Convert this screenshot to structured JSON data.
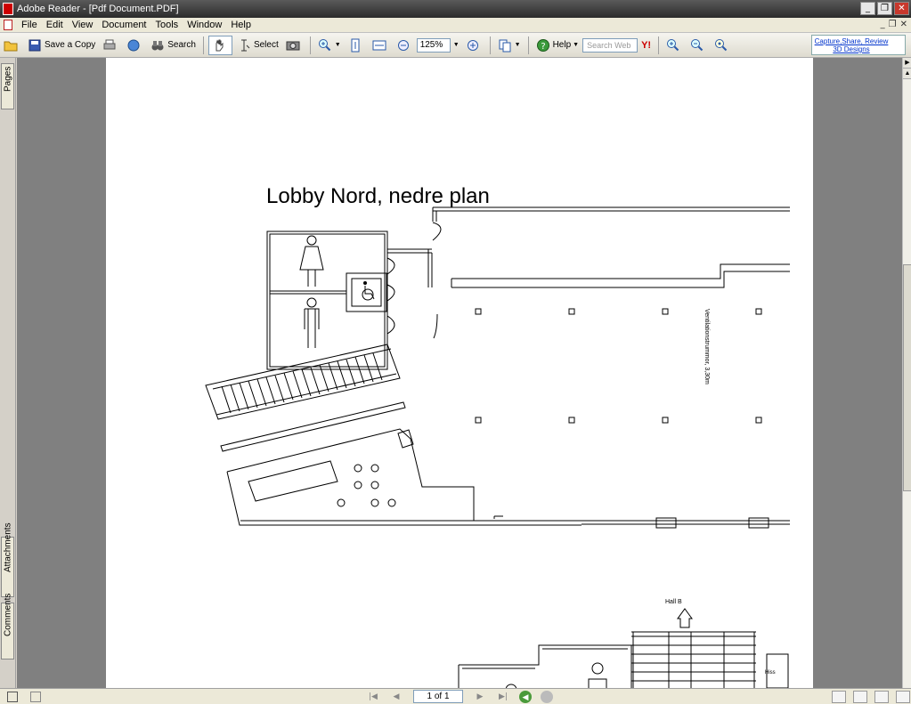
{
  "window": {
    "title": "Adobe Reader - [Pdf Document.PDF]",
    "minimize": "_",
    "restore": "❐",
    "close": "✕"
  },
  "menu": {
    "items": [
      "File",
      "Edit",
      "View",
      "Document",
      "Tools",
      "Window",
      "Help"
    ]
  },
  "toolbar": {
    "save_copy_label": "Save a Copy",
    "search_label": "Search",
    "select_label": "Select",
    "zoom_value": "125%",
    "help_label": "Help",
    "search_web_placeholder": "Search Web",
    "promo_text": "Capture,Share, Review 3D Designs"
  },
  "sidebar": {
    "tabs": [
      "Pages",
      "Attachments",
      "Comments"
    ]
  },
  "document": {
    "plan_title": "Lobby Nord, nedre plan",
    "vent_label": "Ventilationstrummor, 3,30m",
    "hall_label": "Hall B",
    "lift_label": "Hiss"
  },
  "status": {
    "page_indicator": "1 of 1"
  }
}
